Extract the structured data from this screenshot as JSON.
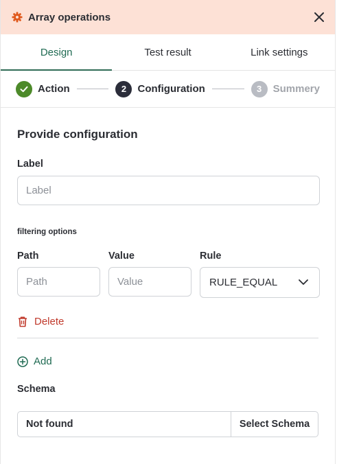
{
  "header": {
    "title": "Array operations",
    "accent_color": "#fde1d6",
    "icon": "gear-icon",
    "close_icon": "close-icon"
  },
  "tabs": [
    {
      "label": "Design",
      "active": true
    },
    {
      "label": "Test result",
      "active": false
    },
    {
      "label": "Link settings",
      "active": false
    }
  ],
  "steps": [
    {
      "number": "✓",
      "label": "Action",
      "state": "done"
    },
    {
      "number": "2",
      "label": "Configuration",
      "state": "current"
    },
    {
      "number": "3",
      "label": "Summery",
      "state": "pending"
    }
  ],
  "form": {
    "section_title": "Provide configuration",
    "label_field": {
      "label": "Label",
      "placeholder": "Label",
      "value": ""
    },
    "filtering_title": "filtering options",
    "path_field": {
      "label": "Path",
      "placeholder": "Path",
      "value": ""
    },
    "value_field": {
      "label": "Value",
      "placeholder": "Value",
      "value": ""
    },
    "rule_field": {
      "label": "Rule",
      "selected": "RULE_EQUAL"
    },
    "delete_label": "Delete",
    "add_label": "Add",
    "schema": {
      "label": "Schema",
      "value": "Not found",
      "button": "Select Schema"
    }
  },
  "colors": {
    "primary_green": "#1f6a52",
    "done_green": "#4d8a2a",
    "danger_red": "#c0392b"
  }
}
